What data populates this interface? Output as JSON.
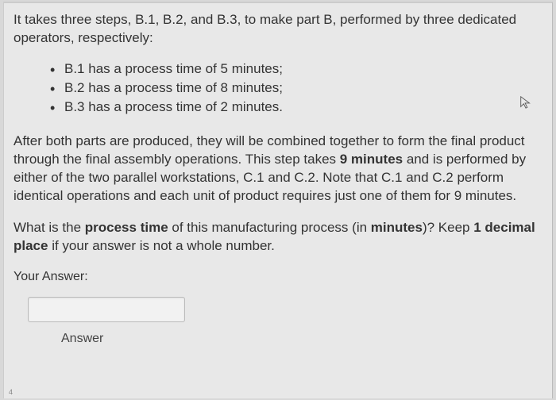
{
  "intro": "It takes three steps, B.1, B.2, and B.3, to make part B, performed by three dedicated operators, respectively:",
  "steps": [
    "B.1 has a process time of 5 minutes;",
    "B.2 has a process time of 8 minutes;",
    "B.3 has a process time of 2 minutes."
  ],
  "after_part1": "After both parts are produced, they will be combined together to form the final product through the final assembly operations. This step takes ",
  "bold_time": "9 minutes",
  "after_part2": " and is performed by either of the two parallel workstations, C.1 and C.2. Note that C.1 and C.2 perform identical operations and each unit of product requires just one of them for 9 minutes.",
  "question_part1": "What is the ",
  "question_bold1": "process time",
  "question_part2": " of this manufacturing process (in ",
  "question_bold2": "minutes",
  "question_part3": ")? Keep ",
  "question_bold3": "1 decimal place",
  "question_part4": " if your answer is not a whole number.",
  "your_answer": "Your Answer:",
  "field_label": "Answer",
  "corner_num": "4"
}
